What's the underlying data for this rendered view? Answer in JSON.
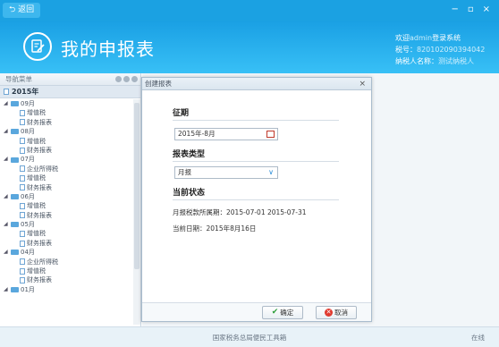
{
  "topbar": {
    "back_label": "返回",
    "minimize": "−",
    "restore": "▫",
    "close": "×"
  },
  "header": {
    "title": "我的申报表",
    "welcome_prefix": "欢迎",
    "username": "admin",
    "welcome_suffix": "登录系统",
    "tax_id_label": "税号：",
    "tax_id": "820102090394042",
    "taxpayer_label": "纳税人名称：",
    "taxpayer_name": "测试纳税人"
  },
  "sidebar": {
    "title": "导航菜单",
    "year": "2015年",
    "tree": [
      {
        "type": "month",
        "label": "09月"
      },
      {
        "type": "leaf",
        "label": "增值税"
      },
      {
        "type": "leaf",
        "label": "财务报表"
      },
      {
        "type": "month",
        "label": "08月"
      },
      {
        "type": "leaf",
        "label": "增值税"
      },
      {
        "type": "leaf",
        "label": "财务报表"
      },
      {
        "type": "month",
        "label": "07月"
      },
      {
        "type": "leaf",
        "label": "企业所得税"
      },
      {
        "type": "leaf",
        "label": "增值税"
      },
      {
        "type": "leaf",
        "label": "财务报表"
      },
      {
        "type": "month",
        "label": "06月"
      },
      {
        "type": "leaf",
        "label": "增值税"
      },
      {
        "type": "leaf",
        "label": "财务报表"
      },
      {
        "type": "month",
        "label": "05月"
      },
      {
        "type": "leaf",
        "label": "增值税"
      },
      {
        "type": "leaf",
        "label": "财务报表"
      },
      {
        "type": "month",
        "label": "04月"
      },
      {
        "type": "leaf",
        "label": "企业所得税"
      },
      {
        "type": "leaf",
        "label": "增值税"
      },
      {
        "type": "leaf",
        "label": "财务报表"
      },
      {
        "type": "month",
        "label": "01月"
      }
    ]
  },
  "dialog": {
    "title": "创建报表",
    "period_heading": "征期",
    "period_value": "2015年-8月",
    "type_heading": "报表类型",
    "type_value": "月报",
    "status_heading": "当前状态",
    "period_range_label": "月报税款所属期：",
    "period_range_value": "2015-07-01 2015-07-31",
    "current_date_label": "当前日期：",
    "current_date_value": "2015年8月16日",
    "ok_label": "确定",
    "cancel_label": "取消"
  },
  "footer": {
    "center_text": "国家税务总局便民工具箱",
    "status": "在线"
  }
}
